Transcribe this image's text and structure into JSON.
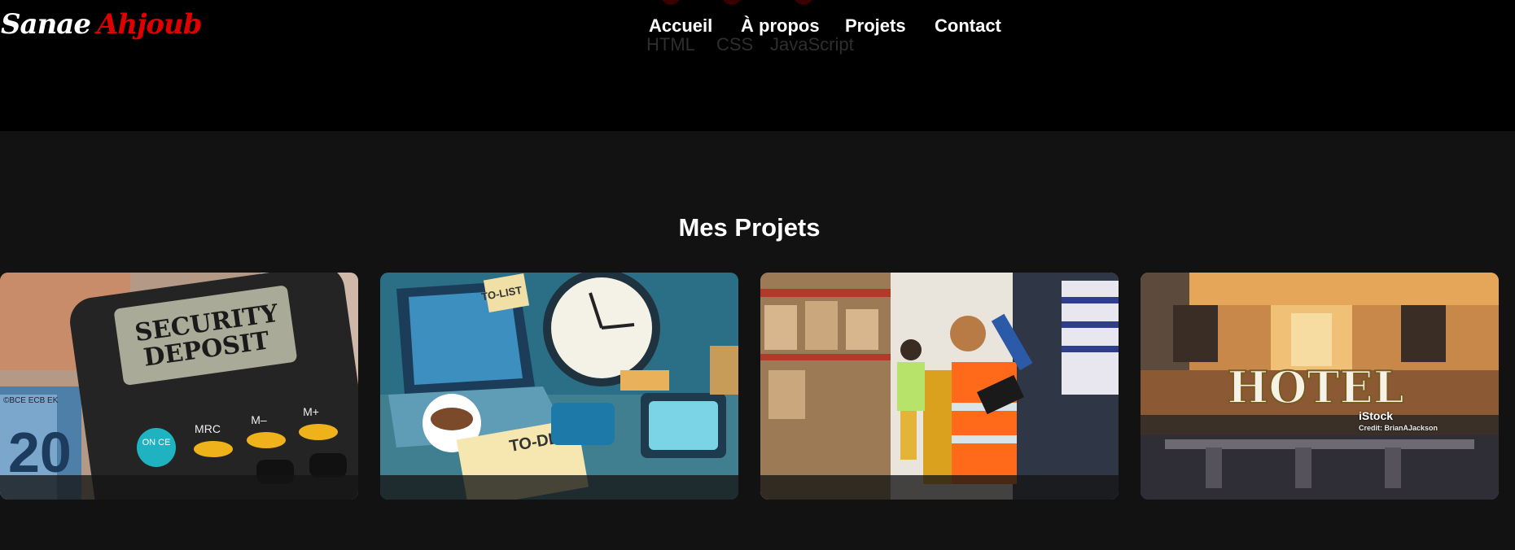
{
  "logo": {
    "first": "Sanae",
    "last": "Ahjoub"
  },
  "nav": {
    "items": [
      {
        "label": "Accueil"
      },
      {
        "label": "À propos"
      },
      {
        "label": "Projets"
      },
      {
        "label": "Contact"
      }
    ]
  },
  "skills": {
    "items": [
      "HTML",
      "CSS",
      "JavaScript"
    ]
  },
  "projects": {
    "title": "Mes Projets",
    "cards": [
      {
        "image_text": [
          "SECURITY",
          "DEPOSIT"
        ],
        "keys": [
          "ON CE",
          "MRC",
          "M–",
          "M+"
        ],
        "banknote": "20",
        "bank_mark": "©BCE ECB EK"
      },
      {
        "image_text": [
          "TO-LIST",
          "TO-DLIST"
        ]
      },
      {
        "image_text": []
      },
      {
        "image_text": [
          "HOTEL"
        ],
        "watermark": "iStock",
        "credit": "Credit: BrianAJackson"
      }
    ]
  },
  "colors": {
    "accent": "#e00000",
    "background": "#121212",
    "header": "#000000"
  }
}
